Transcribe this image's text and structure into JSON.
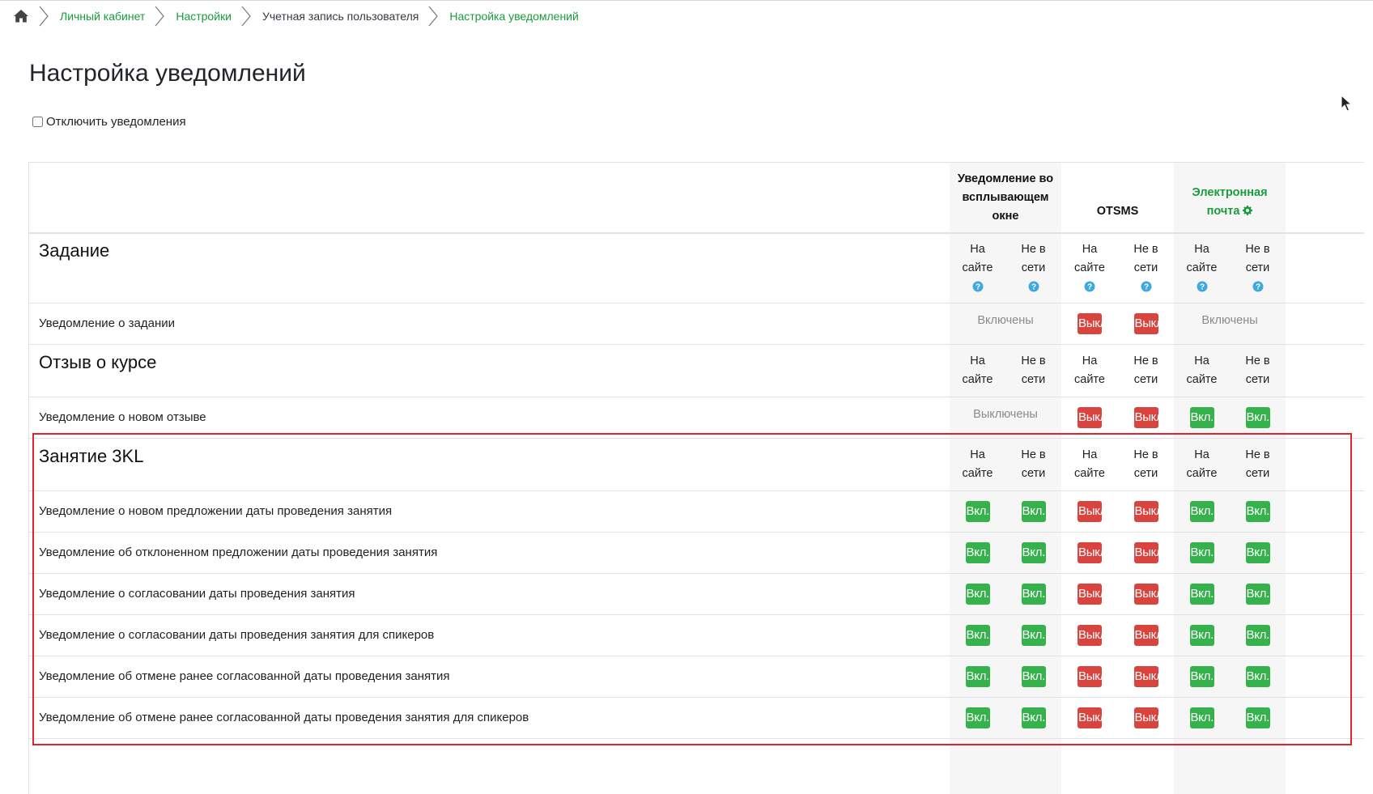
{
  "breadcrumb": {
    "items": [
      {
        "label": "Личный кабинет",
        "type": "link"
      },
      {
        "label": "Настройки",
        "type": "link"
      },
      {
        "label": "Учетная запись пользователя",
        "type": "text"
      },
      {
        "label": "Настройка уведомлений",
        "type": "link"
      }
    ]
  },
  "page": {
    "title": "Настройка уведомлений",
    "disable_label": "Отключить уведомления"
  },
  "columns": {
    "popup": "Уведомление во всплывающем окне",
    "otsms": "OTSMS",
    "email": "Электронная почта"
  },
  "sub": {
    "online": "На сайте",
    "offline": "Не в сети"
  },
  "buttons": {
    "on": "Вкл.",
    "off": "Выкл."
  },
  "sections": [
    {
      "title": "Задание",
      "rows": [
        {
          "label": "Уведомление о задании",
          "popup_status": "Включены",
          "otsms": [
            "off",
            "off"
          ],
          "email_status": "Включены"
        }
      ]
    },
    {
      "title": "Отзыв о курсе",
      "rows": [
        {
          "label": "Уведомление о новом отзыве",
          "popup_status": "Выключены",
          "otsms": [
            "off",
            "off"
          ],
          "email": [
            "on",
            "on"
          ]
        }
      ]
    },
    {
      "title": "Занятие 3KL",
      "rows": [
        {
          "label": "Уведомление о новом предложении даты проведения занятия"
        },
        {
          "label": "Уведомление об отклоненном предложении даты проведения занятия"
        },
        {
          "label": "Уведомление о согласовании даты проведения занятия"
        },
        {
          "label": "Уведомление о согласовании даты проведения занятия для спикеров"
        },
        {
          "label": "Уведомление об отмене ранее согласованной даты проведения занятия"
        },
        {
          "label": "Уведомление об отмене ранее согласованной даты проведения занятия для спикеров"
        }
      ]
    }
  ],
  "colors": {
    "link": "#189c3c",
    "on": "#35b24b",
    "off": "#d9453e",
    "highlight": "#e0242f",
    "help": "#3fa9d9"
  },
  "icons": {
    "home": "home-icon",
    "gear": "gear-icon",
    "help": "question-circle-icon"
  }
}
